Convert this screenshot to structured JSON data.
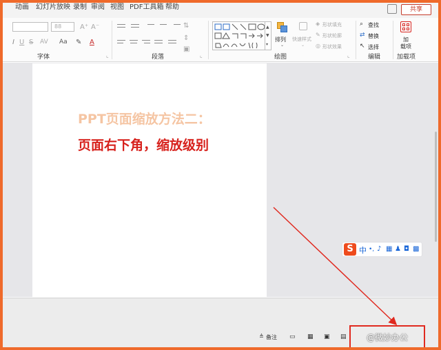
{
  "menubar": {
    "tabs": [
      "动画",
      "幻灯片放映",
      "录制",
      "审阅",
      "视图",
      "PDF工具箱",
      "帮助"
    ],
    "share": "共享"
  },
  "ribbon": {
    "font_group": "字体",
    "font_size": "88",
    "para_group": "段落",
    "draw_group": "绘图",
    "arrange": "排列",
    "quick_styles": "快速样式",
    "shape_fill": "形状填充",
    "shape_outline": "形状轮廓",
    "shape_effects": "形状效果",
    "find": "查找",
    "replace": "替换",
    "select": "选择",
    "edit_group": "编辑",
    "addin_line1": "加",
    "addin_line2": "载项",
    "addin_group": "加载项"
  },
  "slide": {
    "title_line1": "PPT页面缩放方法二：",
    "title_line2": "页面右下角，缩放级别"
  },
  "ime": {
    "lang": "中"
  },
  "status": {
    "notes": "备注"
  },
  "watermark": "@微妙办公",
  "colors": {
    "accent": "#d7211c",
    "faded_title": "#f5c5a3",
    "frame": "#ef6a2b"
  }
}
